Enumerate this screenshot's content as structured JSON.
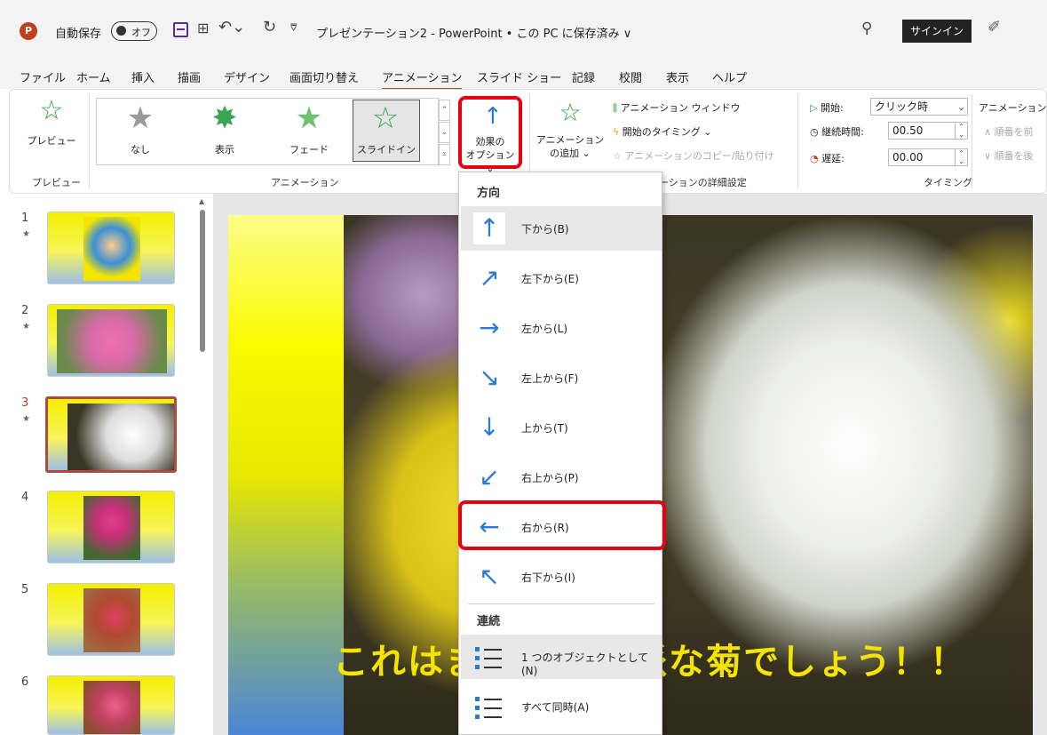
{
  "titlebar": {
    "logo": "P",
    "autosave_label": "自動保存",
    "autosave_state": "オフ",
    "doc_title": "プレゼンテーション2 - PowerPoint • この PC に保存済み ∨",
    "signin": "サインイン",
    "icons": [
      "powerpoint-logo-icon",
      "save-icon",
      "present-icon",
      "undo-icon",
      "redo-icon",
      "search-icon",
      "pen-icon"
    ]
  },
  "tabs": [
    "ファイル",
    "ホーム",
    "挿入",
    "描画",
    "デザイン",
    "画面切り替え",
    "アニメーション",
    "スライド ショー",
    "記録",
    "校閲",
    "表示",
    "ヘルプ"
  ],
  "active_tab": "アニメーション",
  "ribbon": {
    "preview_btn": "プレビュー",
    "preview_group": "プレビュー",
    "animation_group": "アニメーション",
    "gallery": [
      "なし",
      "表示",
      "フェード",
      "スライドイン"
    ],
    "selected_effect": "スライドイン",
    "effect_options_line1": "効果の",
    "effect_options_line2": "オプション ⌄",
    "add_animation_line1": "アニメーション",
    "add_animation_line2": "の追加 ⌄",
    "animation_pane": "アニメーション ウィンドウ",
    "trigger": "開始のタイミング ⌄",
    "painter": "アニメーションのコピー/貼り付け",
    "advanced_group_partial": "ーションの詳細設定",
    "start_label": "開始:",
    "start_value": "クリック時",
    "duration_label": "継続時間:",
    "duration_value": "00.50",
    "delay_label": "遅延:",
    "delay_value": "00.00",
    "timing_group": "タイミング",
    "reorder_label": "アニメーションの",
    "move_earlier": "∧ 順番を前",
    "move_later": "∨ 順番を後"
  },
  "thumbnails": [
    {
      "num": "1",
      "star": "★"
    },
    {
      "num": "2",
      "star": "★"
    },
    {
      "num": "3",
      "star": "★"
    },
    {
      "num": "4",
      "star": ""
    },
    {
      "num": "5",
      "star": ""
    },
    {
      "num": "6",
      "star": ""
    }
  ],
  "selected_slide": "3",
  "slide": {
    "caption": "これはまた何と立派な菊でしょう！！"
  },
  "dropdown": {
    "direction_header": "方向",
    "sequence_header": "連続",
    "directions": [
      {
        "icon": "↑",
        "label": "下から(B)",
        "icon_name": "arrow-up-icon"
      },
      {
        "icon": "↗",
        "label": "左下から(E)",
        "icon_name": "arrow-up-right-icon"
      },
      {
        "icon": "→",
        "label": "左から(L)",
        "icon_name": "arrow-right-icon"
      },
      {
        "icon": "↘",
        "label": "左上から(F)",
        "icon_name": "arrow-down-right-icon"
      },
      {
        "icon": "↓",
        "label": "上から(T)",
        "icon_name": "arrow-down-icon"
      },
      {
        "icon": "↙",
        "label": "右上から(P)",
        "icon_name": "arrow-down-left-icon"
      },
      {
        "icon": "←",
        "label": "右から(R)",
        "icon_name": "arrow-left-icon"
      },
      {
        "icon": "↖",
        "label": "右下から(I)",
        "icon_name": "arrow-up-left-icon"
      }
    ],
    "sequences": [
      {
        "label": "1 つのオブジェクトとして(N)"
      },
      {
        "label": "すべて同時(A)"
      }
    ],
    "selected_direction": "下から(B)",
    "highlighted_direction": "右から(R)"
  },
  "colors": {
    "accent": "#c43e1c",
    "highlight_box": "#e60012",
    "icon_blue": "#2b7bd4",
    "caption": "#f5e400"
  }
}
